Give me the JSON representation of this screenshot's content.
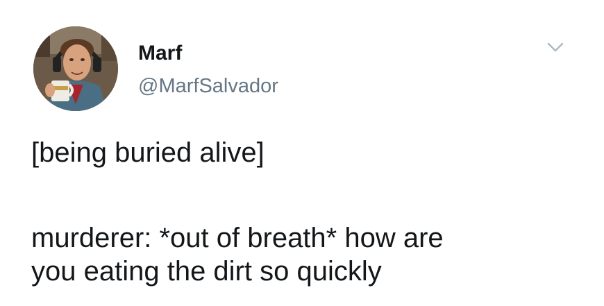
{
  "tweet": {
    "author": {
      "display_name": "Marf",
      "handle": "@MarfSalvador",
      "avatar_icon": "profile-photo"
    },
    "menu_icon": "chevron-down-icon",
    "body": {
      "line1": "[being buried alive]",
      "line2": "murderer: *out of breath* how are",
      "line3": "you eating the dirt so quickly"
    }
  },
  "colors": {
    "background": "#ffffff",
    "text_primary": "#14171a",
    "text_secondary": "#657786",
    "chevron": "#aab8c2"
  }
}
